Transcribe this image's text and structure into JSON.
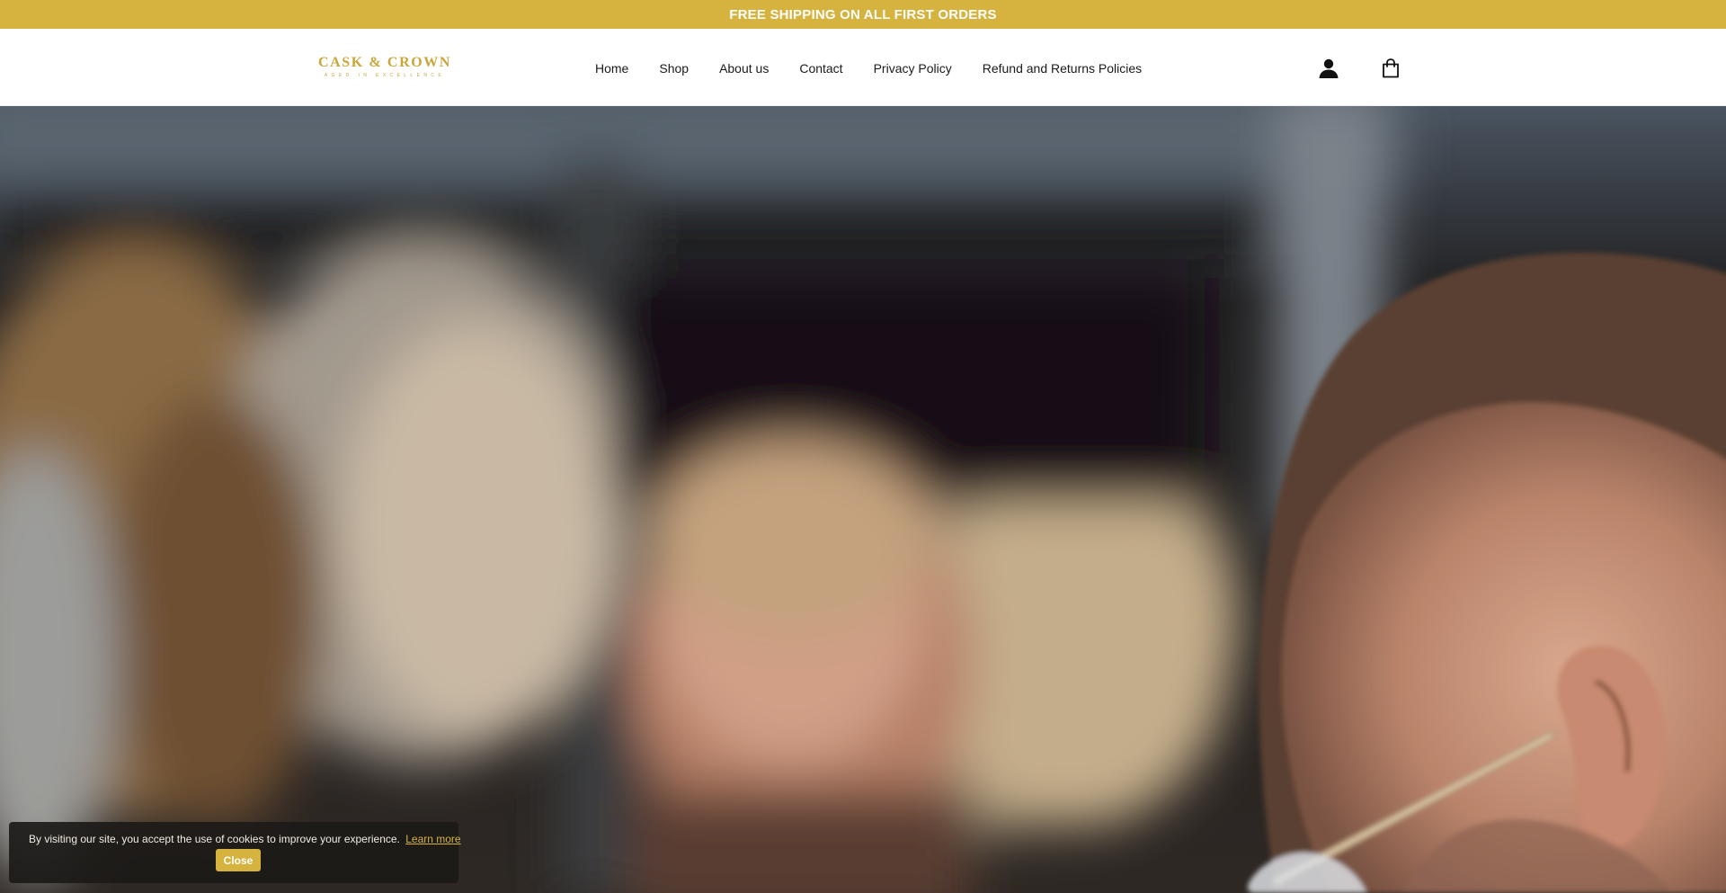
{
  "announcement": {
    "text": "FREE SHIPPING ON ALL FIRST ORDERS"
  },
  "header": {
    "logo": {
      "name": "CASK & CROWN",
      "tagline": "AGED IN EXCELLENCE"
    },
    "nav": [
      {
        "label": "Home"
      },
      {
        "label": "Shop"
      },
      {
        "label": "About us"
      },
      {
        "label": "Contact"
      },
      {
        "label": "Privacy Policy"
      },
      {
        "label": "Refund and Returns Policies"
      }
    ],
    "icons": {
      "account": "user-icon",
      "cart": "shopping-bag-icon"
    }
  },
  "cookie_notice": {
    "text": "By visiting our site, you accept the use of cookies to improve your experience.",
    "link_label": "Learn more",
    "close_label": "Close"
  },
  "colors": {
    "accent": "#d6b23e",
    "logo": "#c9a53a",
    "text": "#1a1a1a",
    "cookie_bg": "#1c1a18"
  }
}
